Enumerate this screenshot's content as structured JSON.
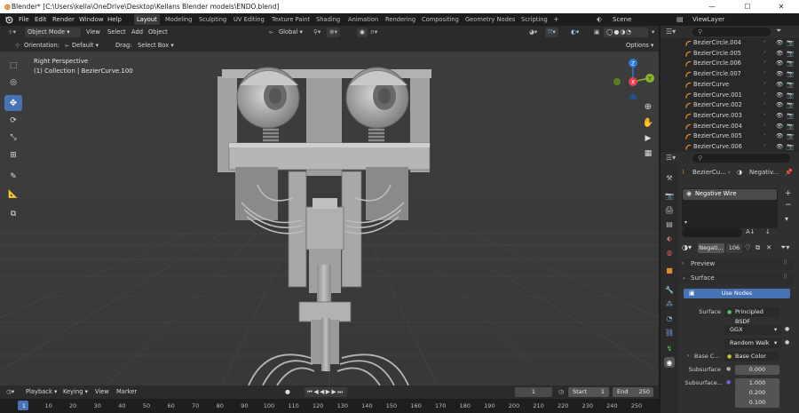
{
  "window": {
    "title": "Blender* [C:\\Users\\kella\\OneDrive\\Desktop\\Kellans Blender models\\ENDO.blend]",
    "minimize": "—",
    "maximize": "☐",
    "close": "✕"
  },
  "menu": [
    "File",
    "Edit",
    "Render",
    "Window",
    "Help"
  ],
  "workspaces": [
    "Layout",
    "Modeling",
    "Sculpting",
    "UV Editing",
    "Texture Paint",
    "Shading",
    "Animation",
    "Rendering",
    "Compositing",
    "Geometry Nodes",
    "Scripting"
  ],
  "add_workspace": "+",
  "scene": {
    "label": "Scene",
    "view_layer": "ViewLayer"
  },
  "viewport_header": {
    "mode": "Object Mode",
    "view": "View",
    "select": "Select",
    "add": "Add",
    "object": "Object",
    "transform_orientation": "Global",
    "options": "Options"
  },
  "tool_settings": {
    "orientation_label": "Orientation:",
    "orientation_value": "Default",
    "drag_label": "Drag:",
    "drag_value": "Select Box"
  },
  "viewport": {
    "perspective": "Right Perspective",
    "collection_info": "(1) Collection | BezierCurve.100"
  },
  "gizmo": {
    "z": "Z",
    "y": "Y",
    "x": "X"
  },
  "outliner": {
    "items": [
      "BezierCircle.004",
      "BezierCircle.005",
      "BezierCircle.006",
      "BezierCircle.007",
      "BezierCurve",
      "BezierCurve.001",
      "BezierCurve.002",
      "BezierCurve.003",
      "BezierCurve.004",
      "BezierCurve.005",
      "BezierCurve.006"
    ]
  },
  "properties": {
    "breadcrumb_object": "BezierCu...",
    "breadcrumb_material": "Negativ...",
    "material_slot": "Negative Wire",
    "material_name": "Negati...",
    "user_count": "106",
    "preview_panel": "Preview",
    "surface_panel": "Surface",
    "use_nodes": "Use Nodes",
    "surface_label": "Surface",
    "surface_value": "Principled BSDF",
    "distribution": "GGX",
    "subsurface_method": "Random Walk",
    "base_color_label": "Base C...",
    "base_color_value": "Base Color",
    "subsurface_label": "Subsurface",
    "subsurface_value": "0.000",
    "subsurface_radius_label": "Subsurface...",
    "subsurface_radius": [
      "1.000",
      "0.200",
      "0.100"
    ]
  },
  "timeline": {
    "playback": "Playback",
    "keying": "Keying",
    "view": "View",
    "marker": "Marker",
    "current_frame": "1",
    "start_label": "Start",
    "start_value": "1",
    "end_label": "End",
    "end_value": "250",
    "ruler": [
      "1",
      "10",
      "20",
      "30",
      "40",
      "50",
      "60",
      "70",
      "80",
      "90",
      "100",
      "110",
      "120",
      "130",
      "140",
      "150",
      "160",
      "170",
      "180",
      "190",
      "200",
      "210",
      "220",
      "230",
      "240",
      "250"
    ]
  },
  "colors": {
    "accent": "#4772b3",
    "viewport_bg": "#3d3d3d",
    "panel_bg": "#2b2b2b",
    "material_orange": "#e08a2c"
  }
}
